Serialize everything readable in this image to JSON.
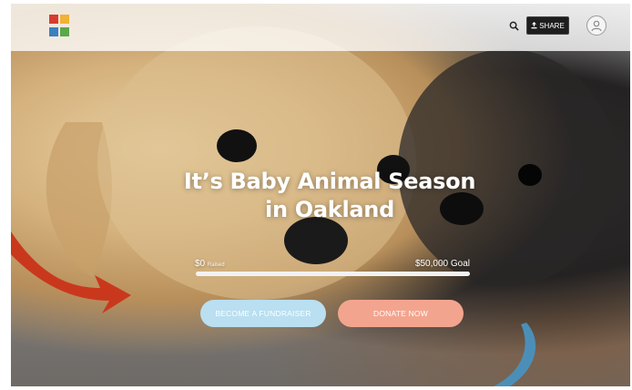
{
  "colors": {
    "arrow_red": "#c9381d",
    "arrow_blue": "#4b8fb9",
    "share_bg": "#1e1e1e",
    "fundraiser_btn": "#b9dff1",
    "donate_btn": "#f3a48f",
    "progress_fill": "#6ab1d6"
  },
  "header": {
    "logo_icon": "logo-icon",
    "search_icon": "search-icon",
    "share_icon": "share-icon",
    "share_label": "SHARE",
    "avatar_icon": "user-icon"
  },
  "hero": {
    "headline_line1": "It’s Baby Animal Season",
    "headline_line2": "in Oakland",
    "raised_amount": "$0",
    "raised_label": "Raised",
    "goal_label": "$50,000 Goal",
    "progress_fraction": 0.0
  },
  "buttons": {
    "fundraiser_label": "BECOME A FUNDRAISER",
    "donate_label": "DONATE NOW"
  }
}
